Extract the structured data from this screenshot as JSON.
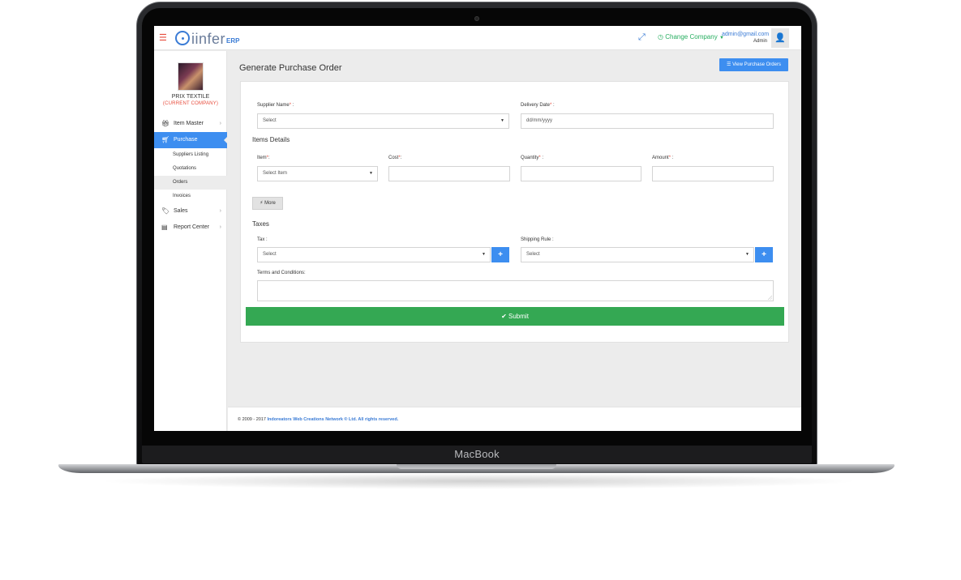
{
  "device": {
    "brand": "MacBook"
  },
  "topbar": {
    "logo_text": "iinfer",
    "logo_suffix": "ERP",
    "company_label": "Change Company",
    "user_email": "admin@gmail.com",
    "user_role": "Admin"
  },
  "sidebar": {
    "company_name": "PRIX TEXTILE",
    "company_status": "(CURRENT COMPANY)",
    "items": [
      {
        "label": "Item Master",
        "icon": "gift-icon"
      },
      {
        "label": "Purchase",
        "icon": "cart-icon",
        "active": true
      },
      {
        "label": "Sales",
        "icon": "tag-icon"
      },
      {
        "label": "Report Center",
        "icon": "bar-chart-icon"
      }
    ],
    "purchase_sub": [
      "Suppliers Listing",
      "Quotations",
      "Orders",
      "Invoices"
    ]
  },
  "page": {
    "title": "Generate Purchase Order",
    "view_button": "View Purchase Orders"
  },
  "form": {
    "supplier_label": "Supplier Name",
    "supplier_value": "Select",
    "delivery_label": "Delivery Date",
    "delivery_placeholder": "dd/mm/yyyy",
    "items_heading": "Items Details",
    "item_label": "Item",
    "item_value": "Select Item",
    "cost_label": "Cost",
    "quantity_label": "Quantity",
    "amount_label": "Amount",
    "more_label": "More",
    "taxes_heading": "Taxes",
    "tax_label": "Tax :",
    "tax_value": "Select",
    "shipping_label": "Shipping Rule :",
    "shipping_value": "Select",
    "terms_label": "Terms and Conditions:",
    "submit_label": "Submit"
  },
  "footer": {
    "text": "© 2009 - 2017",
    "link": "Indoreators Web Creations Network ® Ltd. All rights reserved."
  },
  "colors": {
    "accent": "#3d8ef0",
    "success": "#34a853",
    "danger": "#e74c3c"
  }
}
